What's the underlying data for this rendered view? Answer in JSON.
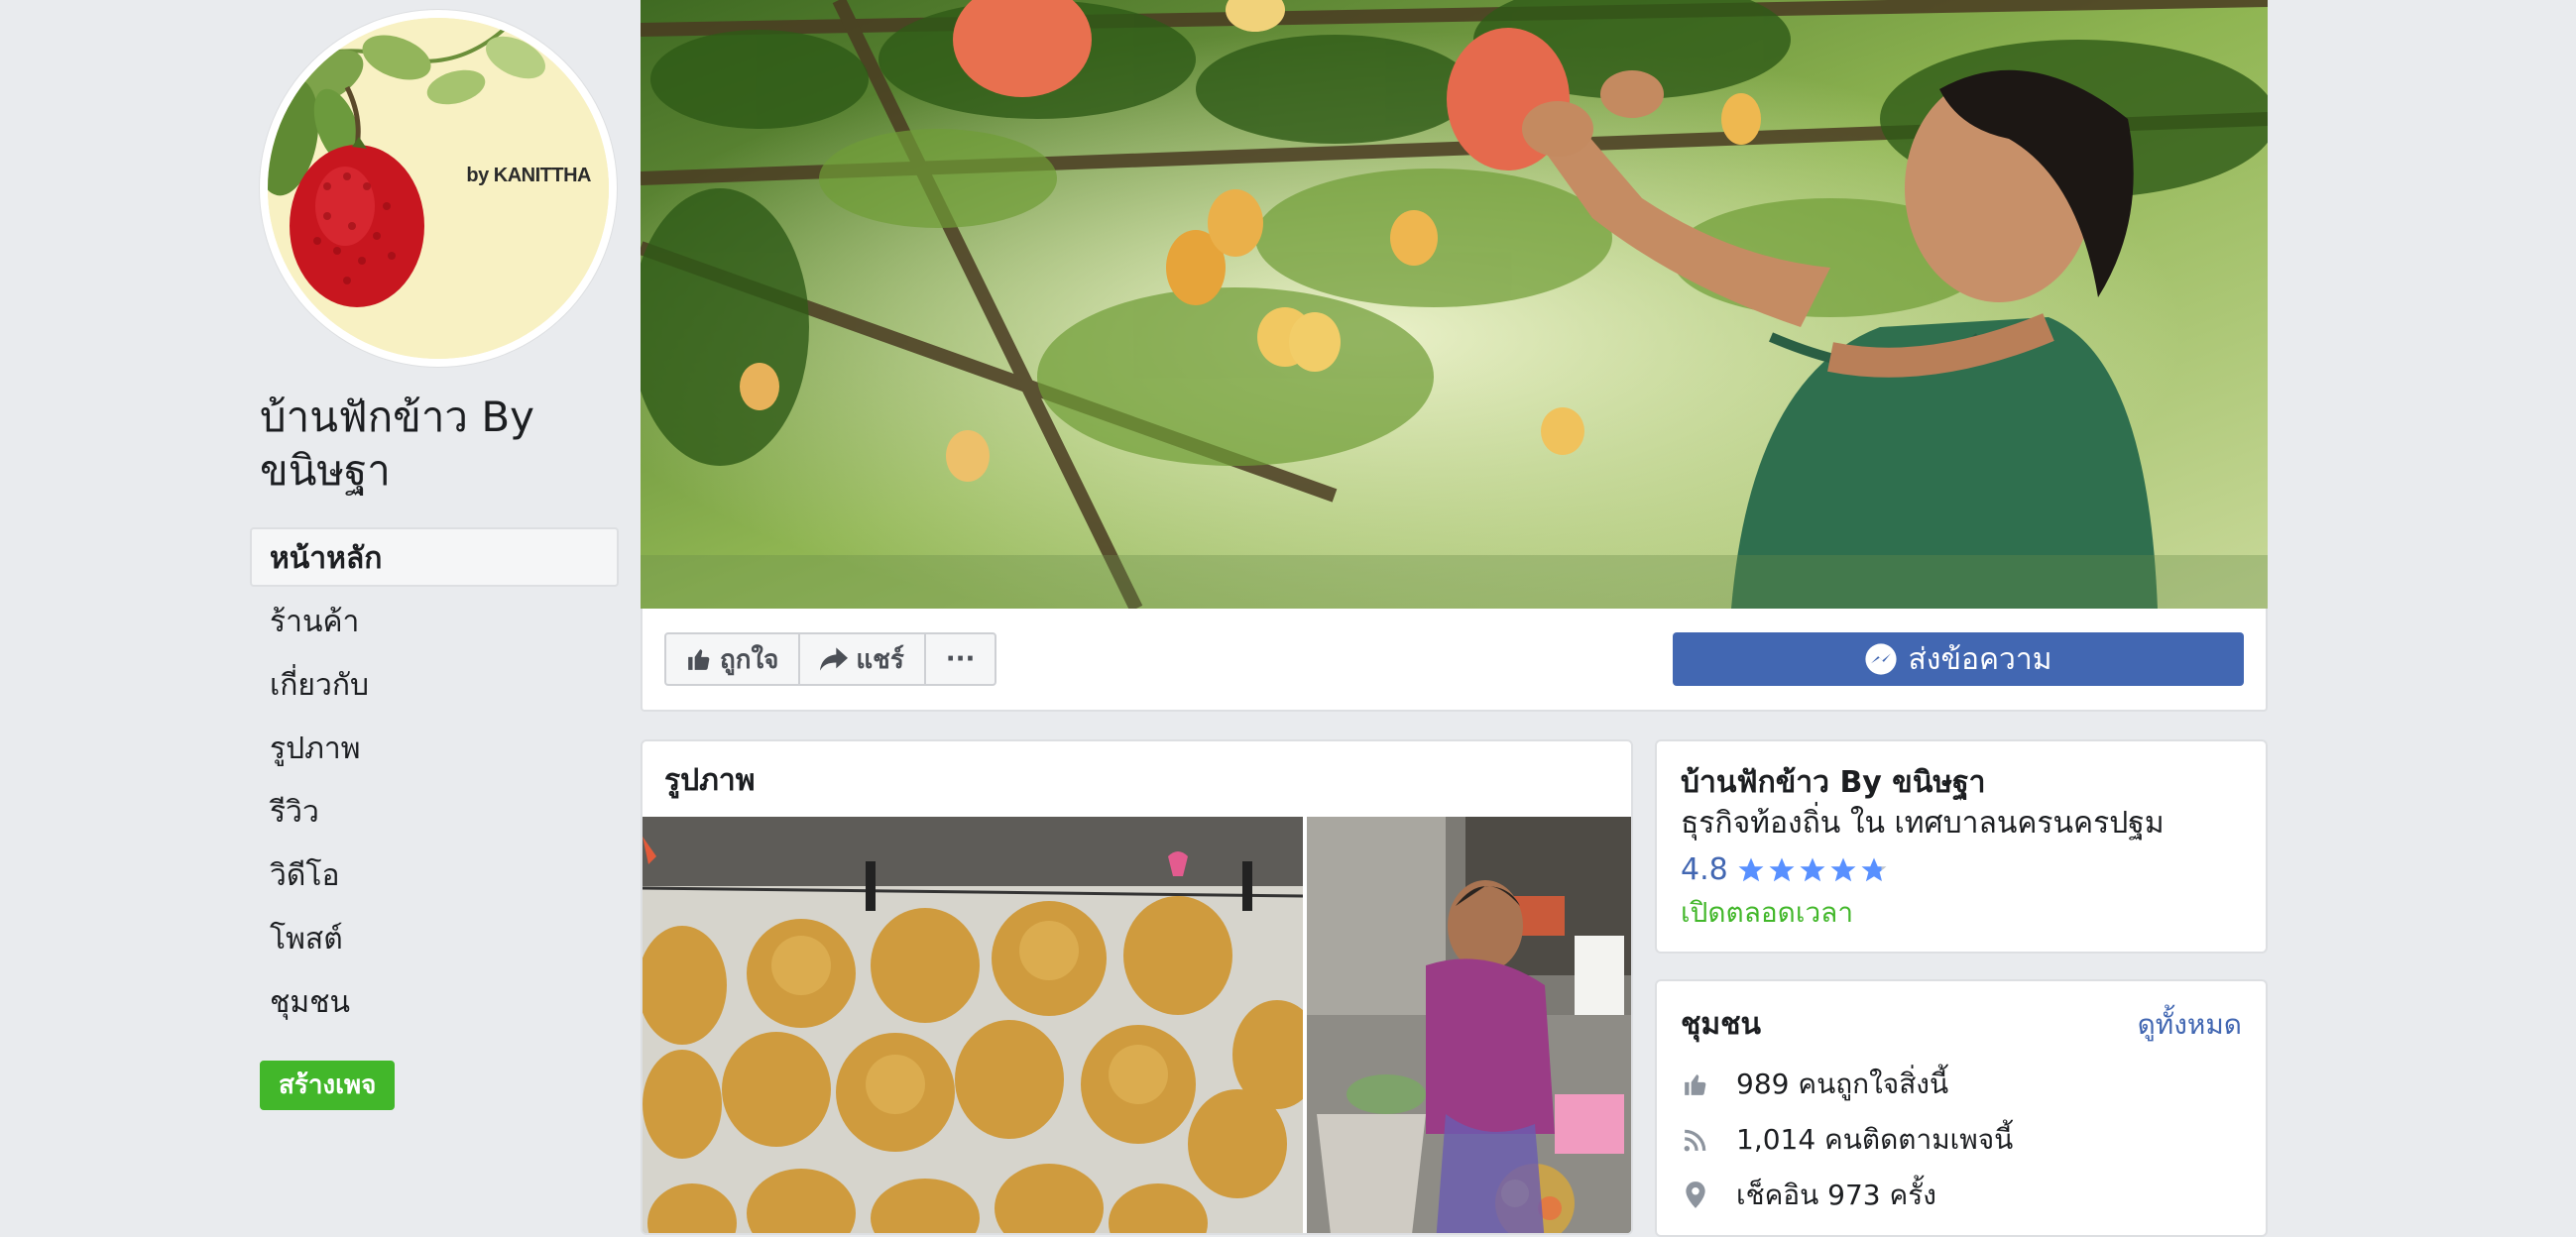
{
  "page": {
    "name": "บ้านฟักข้าว By ขนิษฐา",
    "avatar_caption": "by KANITTHA"
  },
  "sidebar": {
    "items": [
      {
        "label": "หน้าหลัก",
        "active": true
      },
      {
        "label": "ร้านค้า",
        "active": false
      },
      {
        "label": "เกี่ยวกับ",
        "active": false
      },
      {
        "label": "รูปภาพ",
        "active": false
      },
      {
        "label": "รีวิว",
        "active": false
      },
      {
        "label": "วิดีโอ",
        "active": false
      },
      {
        "label": "โพสต์",
        "active": false
      },
      {
        "label": "ชุมชน",
        "active": false
      }
    ],
    "create_page_label": "สร้างเพจ"
  },
  "actions": {
    "like_label": "ถูกใจ",
    "share_label": "แชร์",
    "more_label": "···",
    "send_message_label": "ส่งข้อความ"
  },
  "photos": {
    "title": "รูปภาพ"
  },
  "info": {
    "name": "บ้านฟักข้าว By ขนิษฐา",
    "category": "ธุรกิจท้องถิ่น ใน เทศบาลนครนครปฐม",
    "rating": "4.8",
    "rating_value": 4.8,
    "open_status": "เปิดตลอดเวลา"
  },
  "community": {
    "title": "ชุมชน",
    "see_all_label": "ดูทั้งหมด",
    "likes": "989 คนถูกใจสิ่งนี้",
    "follows": "1,014 คนติดตามเพจนี้",
    "checkins": "เช็คอิน 973 ครั้ง"
  },
  "colors": {
    "brand_blue": "#4267b2",
    "green": "#42b72a",
    "background": "#e9ebee"
  },
  "icons": {
    "like": "thumbs-up-icon",
    "share": "share-arrow-icon",
    "more": "more-dots-icon",
    "messenger": "messenger-icon",
    "star": "star-icon",
    "rss": "rss-icon",
    "location": "location-pin-icon"
  }
}
